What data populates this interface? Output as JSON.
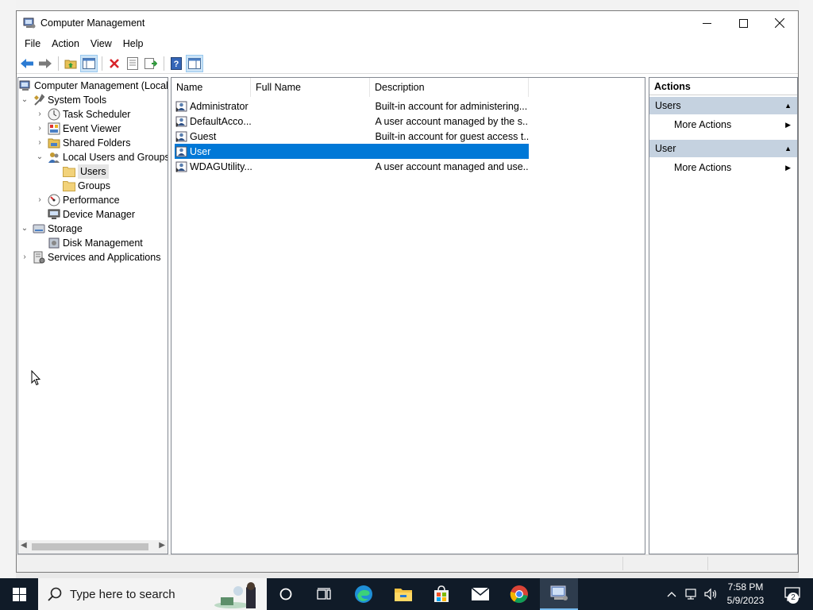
{
  "window": {
    "title": "Computer Management",
    "controls": {
      "minimize": "—",
      "maximize": "☐",
      "close": "✕"
    }
  },
  "menu": [
    "File",
    "Action",
    "View",
    "Help"
  ],
  "toolbar": {
    "buttons": [
      "back-arrow-icon",
      "forward-arrow-icon",
      "up-folder-icon",
      "show-hide-tree-icon",
      "delete-icon",
      "properties-icon",
      "export-list-icon",
      "help-icon",
      "show-hide-action-pane-icon"
    ]
  },
  "tree": {
    "items": [
      {
        "label": "Computer Management (Local",
        "icon": "computer-management-icon",
        "expand": ""
      },
      {
        "label": "System Tools",
        "icon": "system-tools-icon",
        "expand": "expanded"
      },
      {
        "label": "Task Scheduler",
        "icon": "clock-icon",
        "expand": "collapsed"
      },
      {
        "label": "Event Viewer",
        "icon": "event-viewer-icon",
        "expand": "collapsed"
      },
      {
        "label": "Shared Folders",
        "icon": "shared-folder-icon",
        "expand": "collapsed"
      },
      {
        "label": "Local Users and Groups",
        "icon": "users-groups-icon",
        "expand": "expanded"
      },
      {
        "label": "Users",
        "icon": "folder-icon",
        "expand": ""
      },
      {
        "label": "Groups",
        "icon": "folder-icon",
        "expand": ""
      },
      {
        "label": "Performance",
        "icon": "performance-icon",
        "expand": "collapsed"
      },
      {
        "label": "Device Manager",
        "icon": "device-manager-icon",
        "expand": ""
      },
      {
        "label": "Storage",
        "icon": "storage-icon",
        "expand": "expanded"
      },
      {
        "label": "Disk Management",
        "icon": "disk-management-icon",
        "expand": ""
      },
      {
        "label": "Services and Applications",
        "icon": "services-icon",
        "expand": "collapsed"
      }
    ]
  },
  "list": {
    "columns": [
      "Name",
      "Full Name",
      "Description"
    ],
    "rows": [
      {
        "name": "Administrator",
        "full_name": "",
        "description": "Built-in account for administering..."
      },
      {
        "name": "DefaultAcco...",
        "full_name": "",
        "description": "A user account managed by the s..."
      },
      {
        "name": "Guest",
        "full_name": "",
        "description": "Built-in account for guest access t..."
      },
      {
        "name": "User",
        "full_name": "",
        "description": ""
      },
      {
        "name": "WDAGUtility...",
        "full_name": "",
        "description": "A user account managed and use..."
      }
    ],
    "selected_row": "User"
  },
  "actions": {
    "title": "Actions",
    "sections": [
      {
        "header": "Users",
        "item": "More Actions"
      },
      {
        "header": "User",
        "item": "More Actions"
      }
    ]
  },
  "taskbar": {
    "search_placeholder": "Type here to search",
    "apps": [
      "cortana-icon",
      "task-view-icon",
      "edge-icon",
      "file-explorer-icon",
      "store-icon",
      "mail-icon",
      "chrome-icon",
      "computer-management-icon"
    ],
    "time": "7:58 PM",
    "date": "5/9/2023",
    "notification_count": "2"
  },
  "colors": {
    "selection": "#0078d7",
    "action_header": "#c5d2e0",
    "taskbar": "#101b28"
  }
}
